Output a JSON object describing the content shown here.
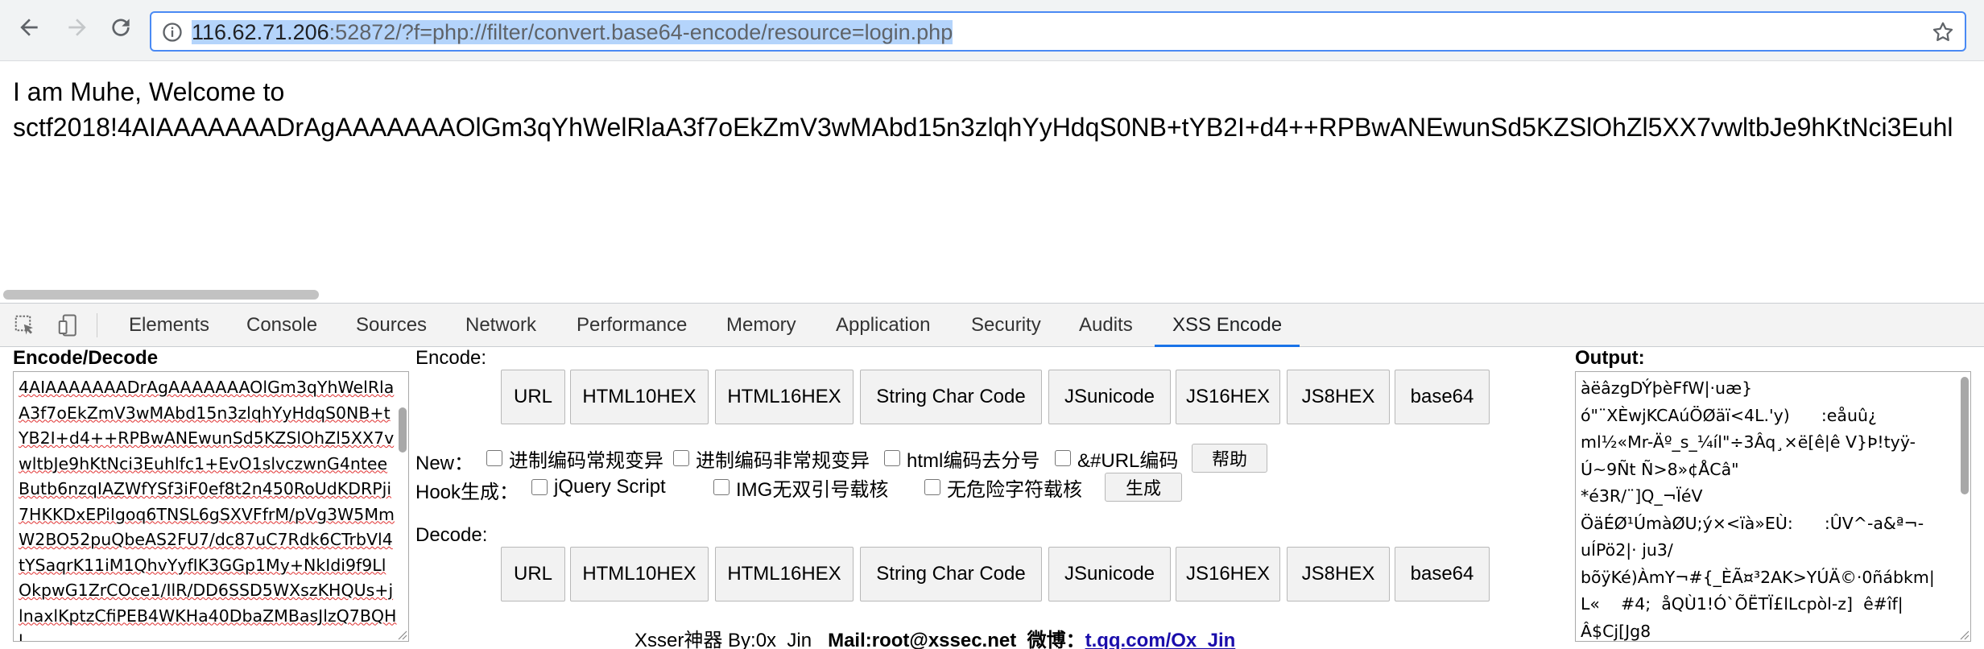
{
  "browser": {
    "url_host": "116.62.71.206",
    "url_rest": ":52872/?f=php://filter/convert.base64-encode/resource=login.php",
    "icons": [
      "back-arrow-icon",
      "forward-arrow-icon",
      "reload-icon",
      "info-icon",
      "bookmark-star-icon"
    ]
  },
  "page": {
    "line1": "I am Muhe, Welcome to",
    "line2": "sctf2018!4AIAAAAAAADrAgAAAAAAAOlGm3qYhWelRlaA3f7oEkZmV3wMAbd15n3zlqhYyHdqS0NB+tYB2I+d4++RPBwANEwunSd5KZSlOhZl5XX7vwltbJe9hKtNci3Euhl"
  },
  "devtools": {
    "tabs": [
      "Elements",
      "Console",
      "Sources",
      "Network",
      "Performance",
      "Memory",
      "Application",
      "Security",
      "Audits",
      "XSS Encode"
    ],
    "active_tab": "XSS Encode"
  },
  "xss": {
    "encode_decode_label": "Encode/Decode",
    "encode_label": "Encode:",
    "decode_label": "Decode:",
    "output_label": "Output:",
    "input_text": "4AIAAAAAAADrAgAAAAAAAOlGm3qYhWelRlaA3f7oEkZmV3wMAbd15n3zlqhYyHdqS0NB+tYB2I+d4++RPBwANEwunSd5KZSlOhZl5XX7vwltbJe9hKtNci3Euhlfc1+EvO1slvczwnG4nteeButb6nzqIAZWfYSf3iF0ef8t2n450RoUdKDRPji7HKKDxEPiIgoq6TNSL6gSXVFfrM/pVg3W5MmW2BO52puQbeAS2FU7/dc87uC7Rdk6CTrbVl4tYSaqrK11iM1QhvYyfIK3GGp1My+NkIdi9f9LlOkpwG1ZrCOce1/IlR/DD6SSD5WXszKHQUs+jlnaxlKptzCfiPEB4WKHa40DbaZMBasJlzQ7BQHl",
    "encode_buttons": [
      "URL",
      "HTML10HEX",
      "HTML16HEX",
      "String Char Code",
      "JSunicode",
      "JS16HEX",
      "JS8HEX",
      "base64"
    ],
    "decode_buttons": [
      "URL",
      "HTML10HEX",
      "HTML16HEX",
      "String Char Code",
      "JSunicode",
      "JS16HEX",
      "JS8HEX",
      "base64"
    ],
    "new_label": "New：",
    "new_options": [
      "进制编码常规变异",
      "进制编码非常规变异",
      "html编码去分号",
      "&#URL编码"
    ],
    "help_button": "帮助",
    "hook_label": "Hook生成：",
    "hook_options": [
      "jQuery Script",
      "IMG无双引号载核",
      "无危险字符载核"
    ],
    "generate_button": "生成",
    "footer": {
      "author": "Xsser神器 By:0x_Jin",
      "mail": "Mail:root@xssec.net",
      "weibo_label": "微博：",
      "weibo_link": "t.qq.com/Ox_Jin"
    },
    "output_text": "àëâzgDÝþèFfW|·uæ}\nó\"¨XÈwjKCAúÖØäï<4L.'y)      :eåuû¿\nml½«Mr-Äº_s_¼íl\"÷3Âq¸×ë[ê|ê V}Þ!tyÿ-\nÚ~9Ñt Ñ>8»¢ÅCâ\"\n*é3R/¨]Q_¬ÏéV\nÖäÉØ¹ÚmàØU;ý×<ïà»EÙ:      :ÛV^-a&ª¬-\nuÍPö2|· ju3/\nbõÿKé)ÀmY¬#{_ÈÃ¤³2AK>YÚÄ©·0ñábkm|\nL«    #4;  åQÙ1!Ó`ÕËTÏ£lLcpòl-z]  ê#îf|\nÂ$Cj[Jg8"
  }
}
